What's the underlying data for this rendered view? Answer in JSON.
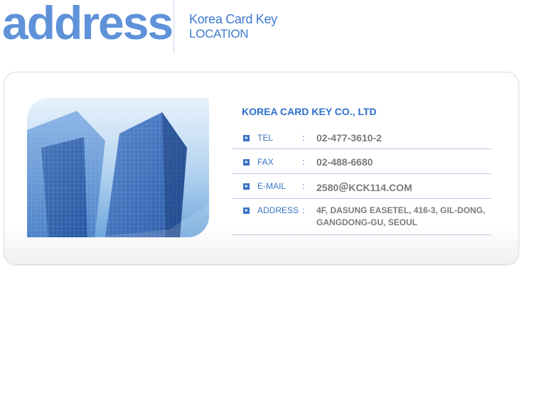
{
  "header": {
    "big_title": "address",
    "subtitle_line1": "Korea Card Key",
    "subtitle_line2": "LOCATION"
  },
  "company_name": "KOREA CARD KEY CO., LTD",
  "info": {
    "tel": {
      "label": "TEL",
      "colon": ":",
      "value": "02-477-3610-2"
    },
    "fax": {
      "label": "FAX",
      "colon": ":",
      "value": "02-488-6680"
    },
    "email": {
      "label": "E-MAIL",
      "colon": ":",
      "value": "2580＠KCK114.COM"
    },
    "address": {
      "label": "ADDRESS",
      "colon": ":",
      "line1": "4F, DASUNG EASETEL, 416-3, GIL-DONG,",
      "line2": "GANGDONG-GU, SEOUL"
    }
  },
  "colors": {
    "title_blue": "#5f92d9",
    "accent_blue": "#2d6fcb",
    "value_gray": "#7a7a7a"
  }
}
